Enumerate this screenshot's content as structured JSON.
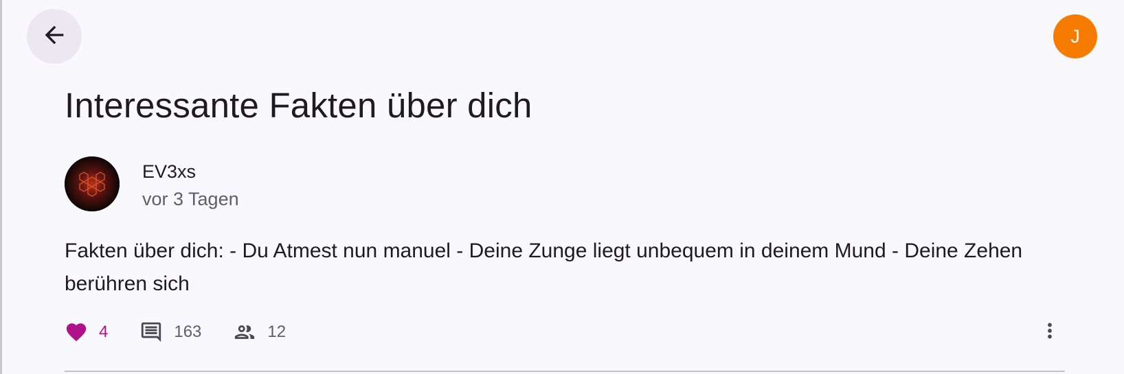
{
  "post": {
    "title": "Interessante Fakten über dich",
    "author": "EV3xs",
    "time": "vor 3 Tagen",
    "body": "Fakten über dich: - Du Atmest nun manuel - Deine Zunge liegt unbequem in deinem Mund - Deine Zehen berühren sich"
  },
  "account": {
    "initial": "J",
    "avatar_color": "#f57c00"
  },
  "stats": {
    "likes": "4",
    "comments": "163",
    "participants": "12"
  },
  "colors": {
    "like_accent": "#b0128a",
    "background": "#f9f8fd"
  },
  "icons": {
    "back": "arrow-left-icon",
    "like": "heart-icon",
    "comments": "comment-icon",
    "participants": "people-icon",
    "more": "more-vertical-icon"
  }
}
